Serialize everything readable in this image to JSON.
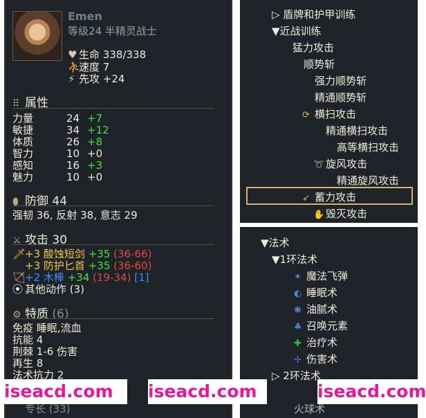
{
  "character": {
    "name": "Emen",
    "level_line": "等级24 半精灵战士",
    "hp_label": "生命",
    "hp_value": "338/338",
    "speed_label": "速度",
    "speed_value": "7",
    "init_label": "先攻",
    "init_value": "+24"
  },
  "attributes": {
    "title": "属性",
    "rows": [
      {
        "label": "力量",
        "value": "24",
        "bonus": "+7"
      },
      {
        "label": "敏捷",
        "value": "34",
        "bonus": "+12"
      },
      {
        "label": "体质",
        "value": "26",
        "bonus": "+8"
      },
      {
        "label": "智力",
        "value": "10",
        "bonus": "+0"
      },
      {
        "label": "感知",
        "value": "16",
        "bonus": "+3"
      },
      {
        "label": "魅力",
        "value": "10",
        "bonus": "+0"
      }
    ]
  },
  "defense": {
    "title": "防御",
    "value": "44",
    "line": "强韧 36, 反射 38, 意志 29"
  },
  "attack": {
    "title": "攻击",
    "value": "30",
    "weapons": [
      {
        "enchant": "+3",
        "name": "酸蚀短剑",
        "hit": "+35",
        "damage": "(36-66)",
        "extra": ""
      },
      {
        "enchant": "+3",
        "name": "防护匕首",
        "hit": "+35",
        "damage": "(36-60)",
        "extra": ""
      },
      {
        "enchant": "+2",
        "name": "木棒",
        "hit": "+34",
        "damage": "(19-34)",
        "extra": "[1]"
      }
    ],
    "other_actions": "其他动作 (3)"
  },
  "traits": {
    "title": "特质",
    "count": "(6)",
    "rows": [
      {
        "label": "免疫",
        "value": "睡眠,流血"
      },
      {
        "label": "抗能",
        "value": "4"
      },
      {
        "label": "荆棘",
        "value": "1-6 伤害"
      },
      {
        "label": "再生",
        "value": "8"
      },
      {
        "label": "法术抗力",
        "value": "2"
      }
    ],
    "cut_off": "专长 (33)"
  },
  "watermark": "iseacd.com",
  "skills_tree": {
    "items": [
      {
        "text": "▷ 盾牌和护甲训练",
        "indent": 0
      },
      {
        "text": "▼近战训练",
        "indent": 0
      },
      {
        "text": "猛力攻击",
        "indent": 1
      },
      {
        "text": "顺势斩",
        "indent": 2
      },
      {
        "text": "强力顺势斩",
        "indent": 3
      },
      {
        "text": "精通顺势斩",
        "indent": 3
      },
      {
        "text": "横扫攻击",
        "indent": 3,
        "icon": "sweep-icon"
      },
      {
        "text": "精通横扫攻击",
        "indent": 4
      },
      {
        "text": "高等横扫攻击",
        "indent": 5
      },
      {
        "text": "旋风攻击",
        "indent": 4,
        "icon": "whirlwind-icon"
      },
      {
        "text": "精通旋风攻击",
        "indent": 5
      },
      {
        "text": "蓄力攻击",
        "indent": 3,
        "icon": "charge-icon",
        "selected": true
      },
      {
        "text": "毁灭攻击",
        "indent": 4,
        "icon": "devastate-icon"
      }
    ]
  },
  "spell_tree": {
    "root": "▼法术",
    "circle1": "▼1环法术",
    "spells": [
      {
        "name": "魔法飞弹",
        "icon": "missile-icon",
        "color": "#5a8fe0"
      },
      {
        "name": "睡眠术",
        "icon": "sleep-icon",
        "color": "#4a86d8"
      },
      {
        "name": "油腻术",
        "icon": "grease-icon",
        "color": "#5aa0e8"
      },
      {
        "name": "召唤元素",
        "icon": "summon-icon",
        "color": "#4a7fd0"
      },
      {
        "name": "治疗术",
        "icon": "heal-icon",
        "color": "#2ec53a"
      },
      {
        "name": "伤害术",
        "icon": "harm-icon",
        "color": "#8a56c8"
      }
    ],
    "circle2": "▷ 2环法术",
    "cut_off": "火球术"
  }
}
